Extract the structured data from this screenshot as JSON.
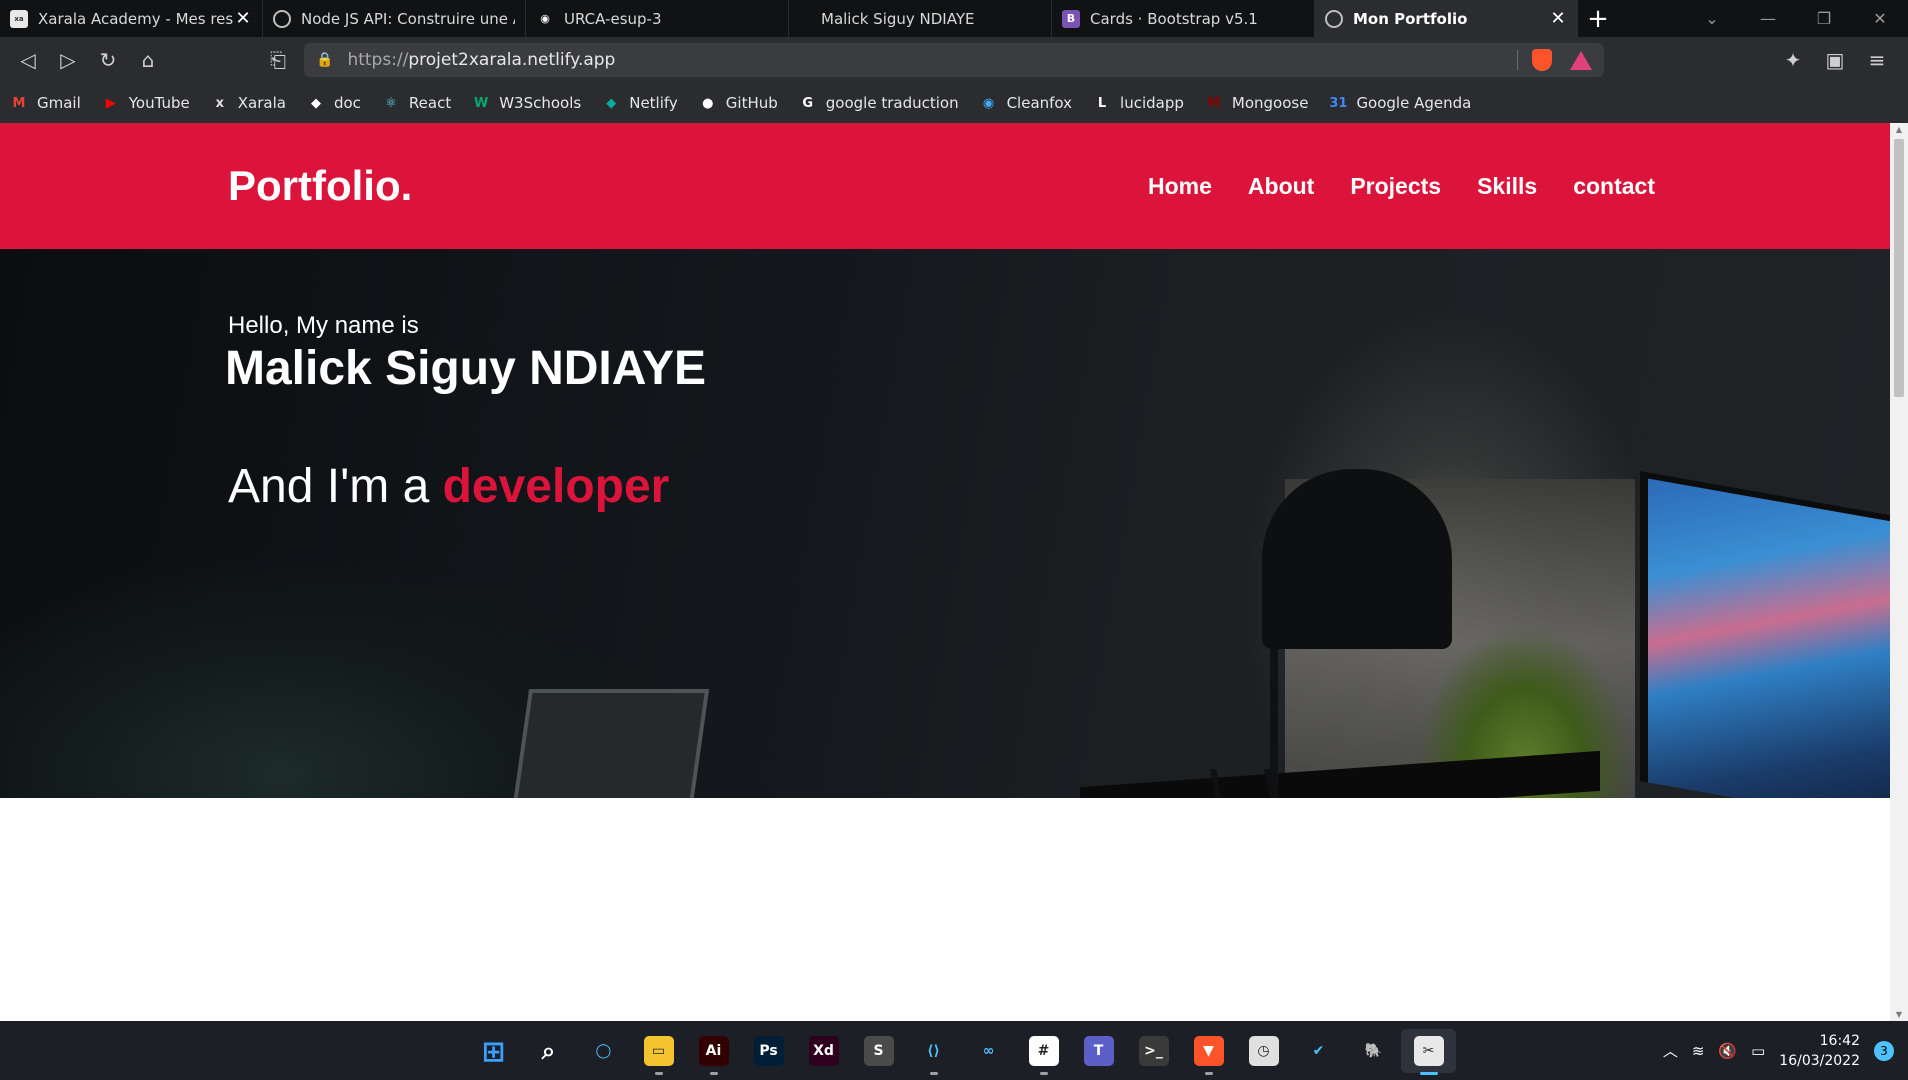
{
  "browser": {
    "tabs": [
      {
        "title": "Xarala Academy - Mes ressou",
        "icon": "xarala-favicon",
        "closable": true,
        "active": false
      },
      {
        "title": "Node JS API: Construire une API",
        "icon": "globe-icon",
        "closable": false,
        "active": false
      },
      {
        "title": "URCA-esup-3",
        "icon": "eye-icon",
        "closable": false,
        "active": false
      },
      {
        "title": "Malick Siguy NDIAYE",
        "icon": "",
        "closable": false,
        "active": false
      },
      {
        "title": "Cards · Bootstrap v5.1",
        "icon": "bootstrap-icon",
        "closable": false,
        "active": false
      },
      {
        "title": "Mon Portfolio",
        "icon": "globe-icon",
        "closable": true,
        "active": true
      }
    ],
    "url": {
      "protocol": "https://",
      "host": "projet2xarala.netlify.app"
    },
    "bookmarks": [
      {
        "label": "Gmail",
        "icon": "gmail-icon",
        "color": "#ea4335",
        "glyph": "M"
      },
      {
        "label": "YouTube",
        "icon": "youtube-icon",
        "color": "#ff0000",
        "glyph": "▶"
      },
      {
        "label": "Xarala",
        "icon": "xarala-icon",
        "color": "#e0e0e0",
        "glyph": "x"
      },
      {
        "label": "doc",
        "icon": "doc-icon",
        "color": "#ffffff",
        "glyph": "◆"
      },
      {
        "label": "React",
        "icon": "react-icon",
        "color": "#61dafb",
        "glyph": "⚛"
      },
      {
        "label": "W3Schools",
        "icon": "w3schools-icon",
        "color": "#04aa6d",
        "glyph": "W"
      },
      {
        "label": "Netlify",
        "icon": "netlify-icon",
        "color": "#00ad9f",
        "glyph": "◆"
      },
      {
        "label": "GitHub",
        "icon": "github-icon",
        "color": "#ffffff",
        "glyph": "●"
      },
      {
        "label": "google traduction",
        "icon": "google-icon",
        "color": "#ffffff",
        "glyph": "G"
      },
      {
        "label": "Cleanfox",
        "icon": "cleanfox-icon",
        "color": "#3fa9f5",
        "glyph": "◉"
      },
      {
        "label": "lucidapp",
        "icon": "lucid-icon",
        "color": "#ffffff",
        "glyph": "L"
      },
      {
        "label": "Mongoose",
        "icon": "mongoose-icon",
        "color": "#880000",
        "glyph": "M"
      },
      {
        "label": "Google Agenda",
        "icon": "calendar-icon",
        "color": "#4285f4",
        "glyph": "31"
      }
    ]
  },
  "site": {
    "logo": "Portfolio.",
    "nav": [
      "Home",
      "About",
      "Projects",
      "Skills",
      "contact"
    ],
    "hero": {
      "greeting": "Hello, My name is",
      "name": "Malick Siguy NDIAYE",
      "role_prefix": "And I'm a ",
      "role_highlight": "developer"
    },
    "colors": {
      "brand": "#dc143c",
      "hero_bg": "#111418"
    }
  },
  "taskbar": {
    "apps": [
      {
        "name": "windows-start-icon",
        "color": "#3aa0ff",
        "glyph": "⊞",
        "running": false
      },
      {
        "name": "search-icon",
        "color": "transparent",
        "glyph": "⌕",
        "running": false
      },
      {
        "name": "cortana-icon",
        "color": "transparent",
        "glyph": "◯",
        "running": false
      },
      {
        "name": "file-explorer-icon",
        "color": "#f4c430",
        "glyph": "▭",
        "running": true
      },
      {
        "name": "illustrator-icon",
        "color": "#330000",
        "glyph": "Ai",
        "running": true
      },
      {
        "name": "photoshop-icon",
        "color": "#001e36",
        "glyph": "Ps",
        "running": false
      },
      {
        "name": "xd-icon",
        "color": "#2e001e",
        "glyph": "Xd",
        "running": false
      },
      {
        "name": "sublime-icon",
        "color": "#4a4a4a",
        "glyph": "S",
        "running": false
      },
      {
        "name": "vscode-icon",
        "color": "transparent",
        "glyph": "⟨⟩",
        "running": true
      },
      {
        "name": "infinity-icon",
        "color": "transparent",
        "glyph": "∞",
        "running": false
      },
      {
        "name": "slack-icon",
        "color": "#ffffff",
        "glyph": "#",
        "running": true
      },
      {
        "name": "teams-icon",
        "color": "#5b5fc7",
        "glyph": "T",
        "running": false
      },
      {
        "name": "terminal-icon",
        "color": "#3a3a3a",
        "glyph": ">_",
        "running": false
      },
      {
        "name": "brave-icon",
        "color": "#fb542b",
        "glyph": "▼",
        "running": true
      },
      {
        "name": "clock-app-icon",
        "color": "#e0e0e0",
        "glyph": "◷",
        "running": false
      },
      {
        "name": "todo-icon",
        "color": "transparent",
        "glyph": "✔",
        "running": false
      },
      {
        "name": "postgres-icon",
        "color": "transparent",
        "glyph": "🐘",
        "running": false
      },
      {
        "name": "snip-icon",
        "color": "#e8e8e8",
        "glyph": "✂",
        "running": true,
        "active": true
      }
    ],
    "time": "16:42",
    "date": "16/03/2022",
    "notification_count": "3"
  }
}
